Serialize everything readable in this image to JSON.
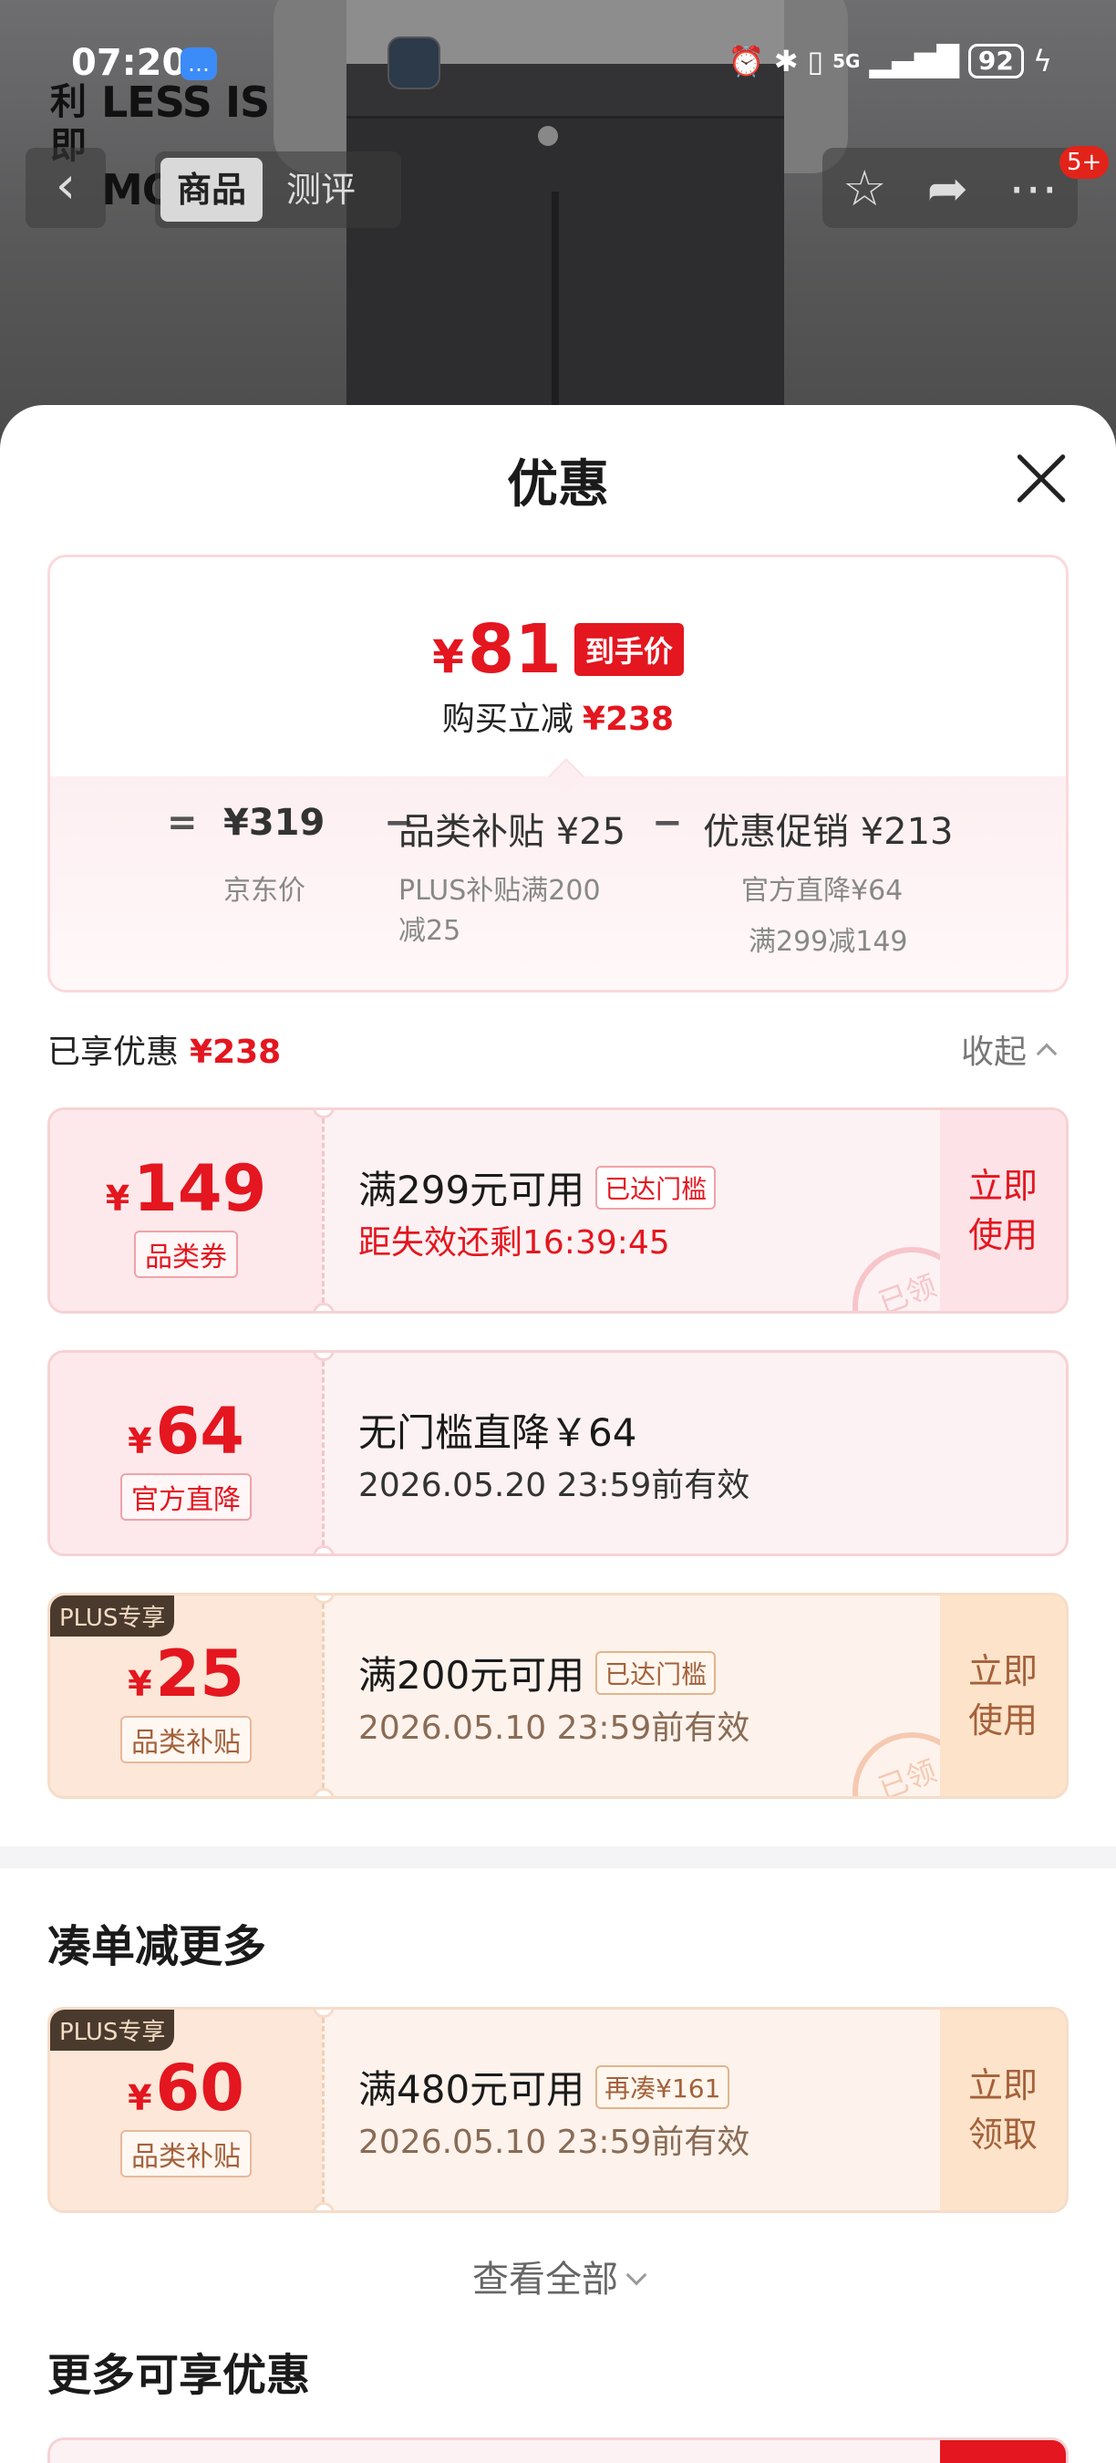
{
  "status_bar": {
    "time": "07:20",
    "battery": "92",
    "signal": "5G"
  },
  "hero": {
    "logo_cn": "利即",
    "logo_en_line1": "LESS IS",
    "logo_en_line2": "MORE"
  },
  "nav": {
    "back_icon": "chevron-left-icon",
    "tabs": [
      {
        "label": "商品",
        "active": true
      },
      {
        "label": "测评",
        "active": false
      }
    ],
    "actions": [
      "star-icon",
      "share-icon",
      "more-icon"
    ],
    "badge": "5+"
  },
  "sheet": {
    "title": "优惠",
    "summary": {
      "final_price": "81",
      "final_tag": "到手价",
      "reduce_label": "购买立减",
      "reduce_amount": "¥238",
      "formula": {
        "eq": "=",
        "jd_price": "¥319",
        "jd_label": "京东价",
        "minus1": "−",
        "subsidy": "品类补贴 ¥25",
        "subsidy_desc_1": "PLUS补贴满200",
        "subsidy_desc_2": "减25",
        "minus2": "−",
        "promo": "优惠促销 ¥213",
        "promo_desc_1": "官方直降¥64",
        "promo_desc_2": "满299减149"
      }
    },
    "enjoyed": {
      "label": "已享优惠",
      "amount": "¥238",
      "collapse": "收起"
    },
    "coupons": [
      {
        "amount": "149",
        "type": "品类券",
        "main": "满299元可用",
        "tag": "已达门槛",
        "sub": "距失效还剩16:39:45",
        "action_1": "立即",
        "action_2": "使用",
        "stamp": "已领"
      },
      {
        "amount": "64",
        "type": "官方直降",
        "main": "无门槛直降￥64",
        "sub": "2026.05.20 23:59前有效"
      },
      {
        "plus": "PLUS专享",
        "amount": "25",
        "type": "品类补贴",
        "main": "满200元可用",
        "tag": "已达门槛",
        "sub": "2026.05.10 23:59前有效",
        "action_1": "立即",
        "action_2": "使用",
        "stamp": "已领"
      }
    ],
    "more_section": {
      "title": "凑单减更多",
      "coupon": {
        "plus": "PLUS专享",
        "amount": "60",
        "type": "品类补贴",
        "main": "满480元可用",
        "tag": "再凑¥161",
        "sub": "2026.05.10 23:59前有效",
        "action_1": "立即",
        "action_2": "领取"
      },
      "view_all": "查看全部"
    },
    "extra_section": {
      "title": "更多可享优惠"
    }
  }
}
